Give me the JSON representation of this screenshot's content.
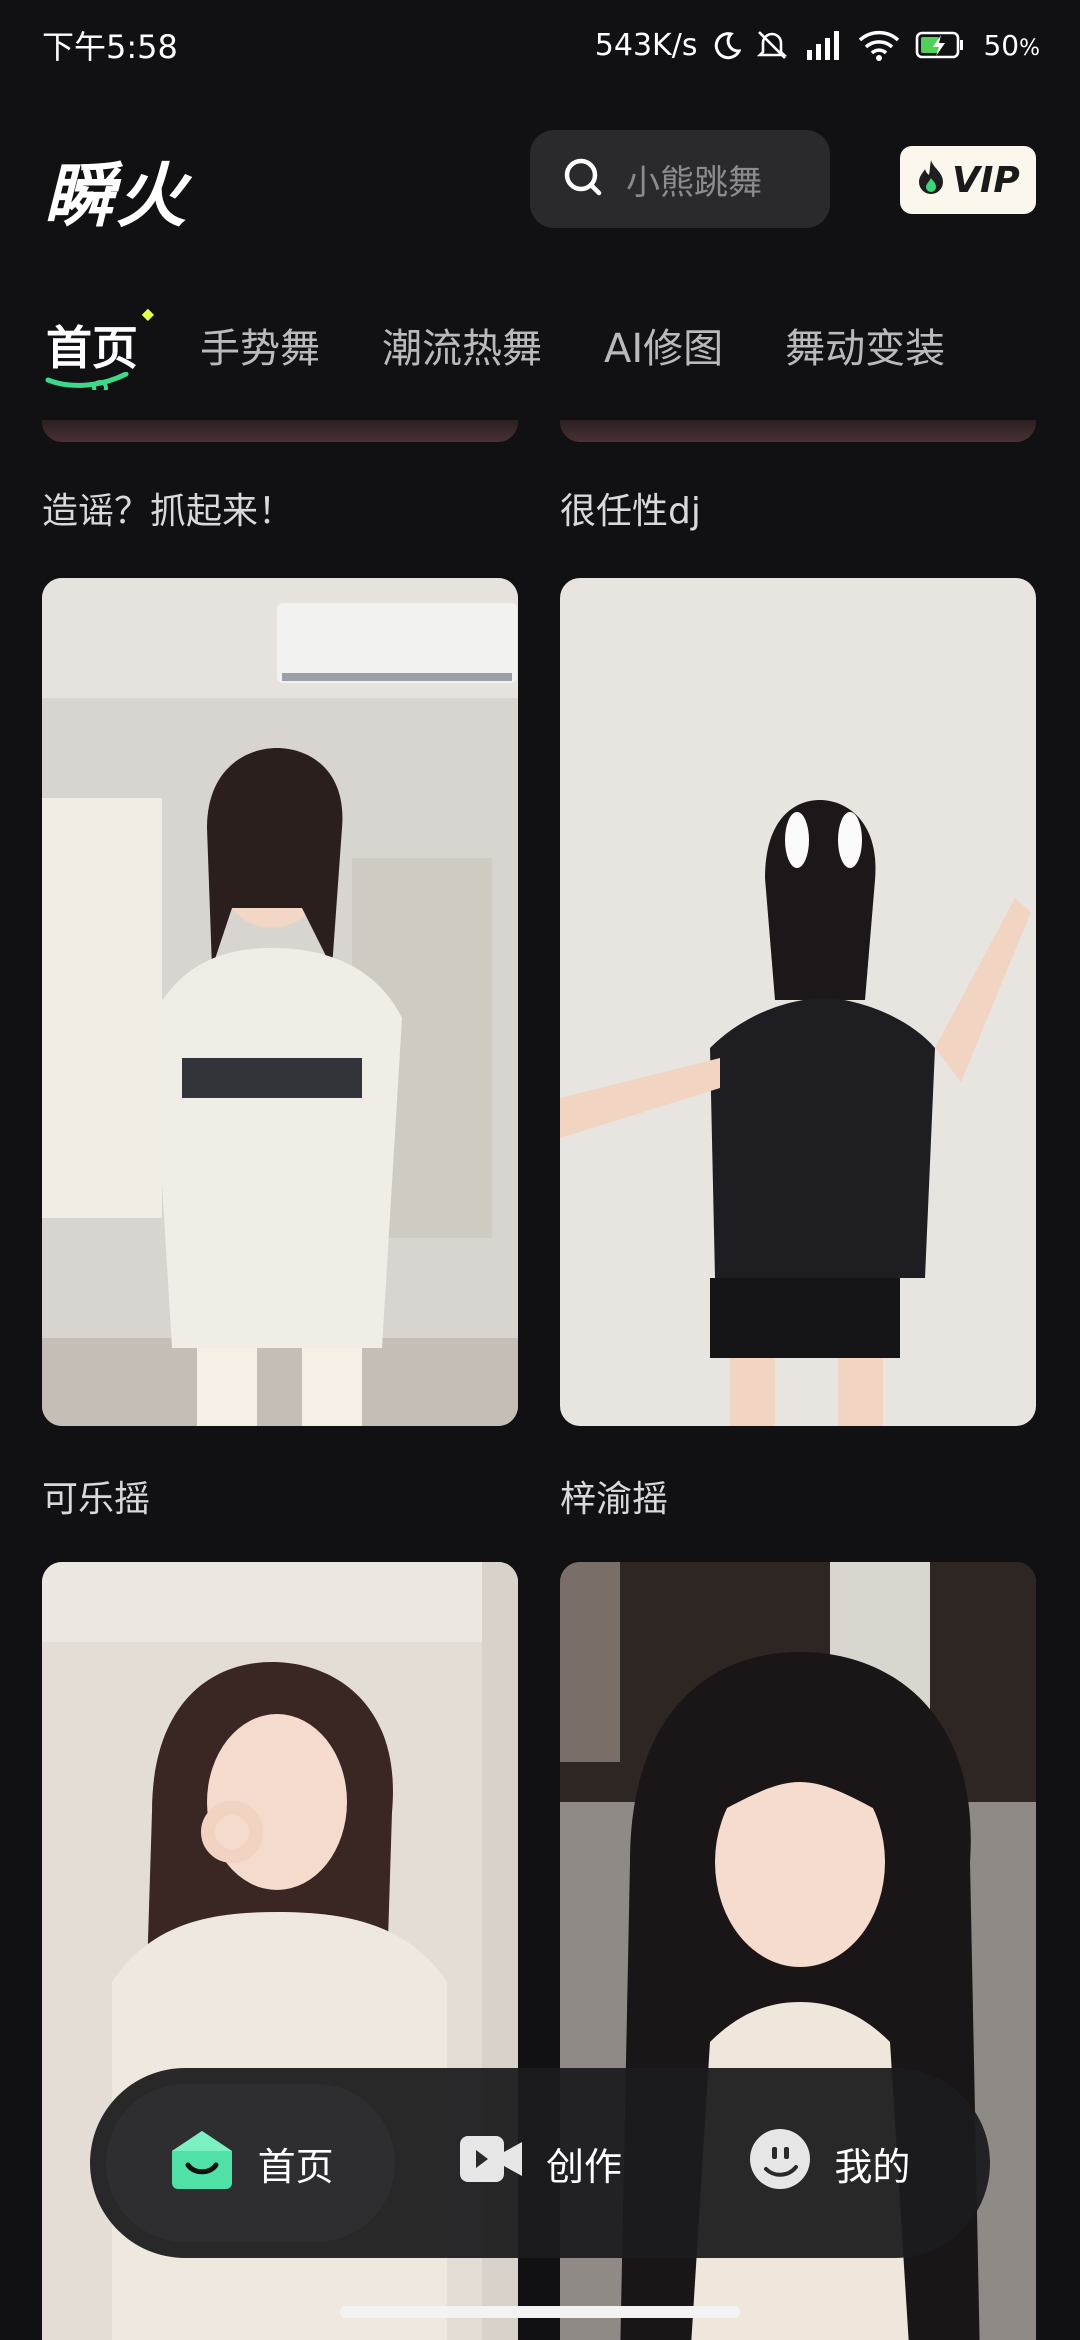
{
  "status_bar": {
    "time": "下午5:58",
    "network_speed": "543K/s",
    "battery": "50",
    "battery_unit": "%"
  },
  "header": {
    "logo": "瞬火",
    "search_placeholder": "小熊跳舞",
    "vip_label": "VIP"
  },
  "tabs": [
    {
      "label": "首页",
      "active": true
    },
    {
      "label": "手势舞",
      "active": false
    },
    {
      "label": "潮流热舞",
      "active": false
    },
    {
      "label": "AI修图",
      "active": false
    },
    {
      "label": "舞动变装",
      "active": false
    }
  ],
  "feed": {
    "top_captions": [
      "造谣？抓起来！",
      "很任性dj"
    ],
    "cards": [
      {
        "caption": "可乐摇"
      },
      {
        "caption": "梓渝摇"
      },
      {
        "caption": ""
      },
      {
        "caption": ""
      }
    ]
  },
  "bottom_nav": [
    {
      "label": "首页",
      "icon": "home-smile-icon",
      "active": true
    },
    {
      "label": "创作",
      "icon": "video-camera-icon",
      "active": false
    },
    {
      "label": "我的",
      "icon": "profile-face-icon",
      "active": false
    }
  ]
}
